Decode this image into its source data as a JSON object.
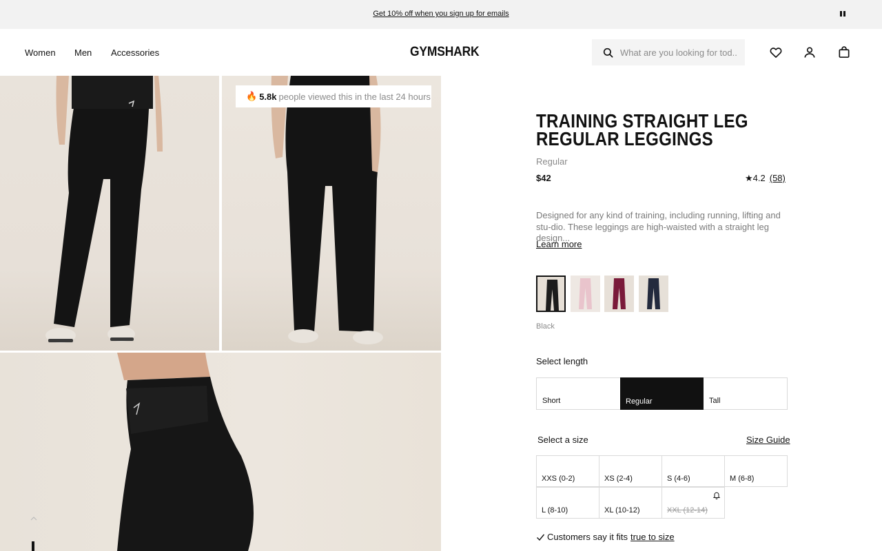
{
  "promo": {
    "text": "Get 10% off when you sign up for emails"
  },
  "nav": {
    "women": "Women",
    "men": "Men",
    "accessories": "Accessories"
  },
  "brand": {
    "logo": "GYMSHARK"
  },
  "search": {
    "placeholder": "What are you looking for tod..."
  },
  "gallery": {
    "viewed_count": "5.8k",
    "viewed_text": "people viewed this in the last 24 hours"
  },
  "product": {
    "title": "Training Straight Leg Regular Leggings",
    "subtitle": "Regular",
    "price": "$42",
    "rating": "★4.2",
    "review_count": "(58)",
    "description": "Designed for any kind of training, including running, lifting and stu-dio. These leggings are high-waisted with a straight leg design...",
    "learn_more": "Learn more",
    "selected_colour": "Black",
    "swatches": [
      {
        "name": "Black",
        "color": "#1c1c1c",
        "bg": "#e6dfd6"
      },
      {
        "name": "Pink",
        "color": "#e9c4cc",
        "bg": "#eee8e3"
      },
      {
        "name": "Burgundy",
        "color": "#7a1a3a",
        "bg": "#e7e0d8"
      },
      {
        "name": "Navy",
        "color": "#232a3d",
        "bg": "#e6e0d8"
      }
    ]
  },
  "length": {
    "label": "Select length",
    "options": [
      "Short",
      "Regular",
      "Tall"
    ],
    "selected": "Regular"
  },
  "size": {
    "label": "Select a size",
    "guide": "Size Guide",
    "options": [
      "XXS (0-2)",
      "XS (2-4)",
      "S (4-6)",
      "M (6-8)",
      "L (8-10)",
      "XL (10-12)",
      "XXL (12-14)"
    ],
    "out_of_stock": [
      "XXL (12-14)"
    ]
  },
  "fit": {
    "text": "Customers say it fits",
    "link": "true to size"
  },
  "colors": {
    "accent": "#111111",
    "muted_text": "#8a8a8a",
    "promo_bg": "#f2f2f2"
  }
}
